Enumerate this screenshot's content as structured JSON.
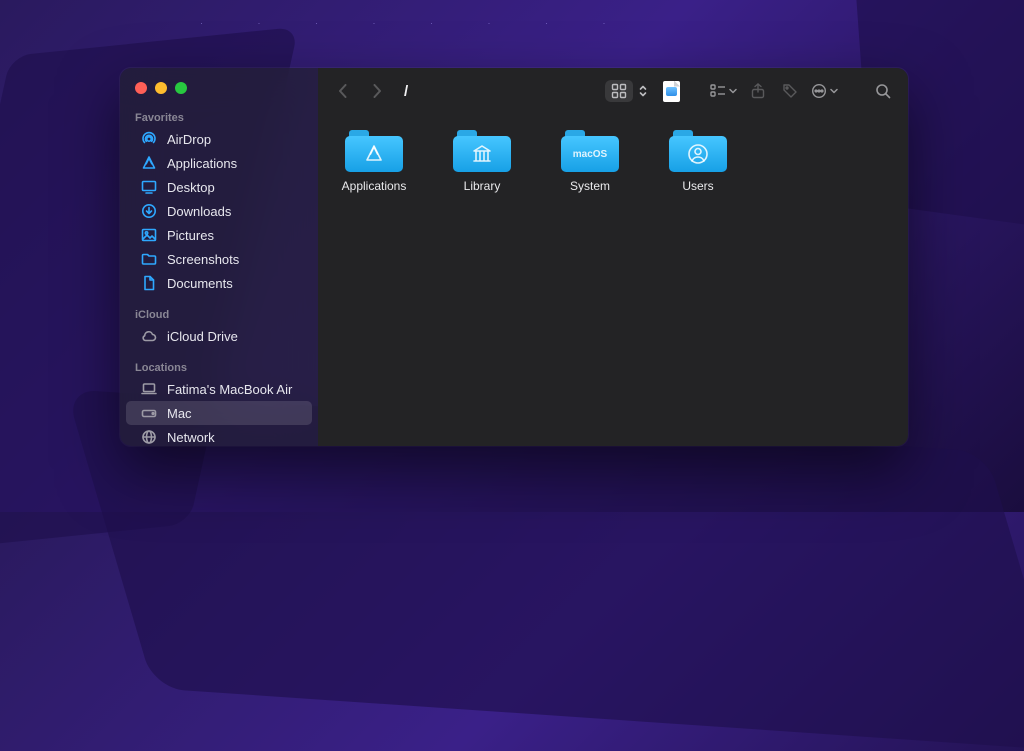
{
  "path_title": "/",
  "sidebar": {
    "sections": [
      {
        "label": "Favorites",
        "items": [
          {
            "icon": "airdrop",
            "label": "AirDrop"
          },
          {
            "icon": "apps",
            "label": "Applications"
          },
          {
            "icon": "desktop",
            "label": "Desktop"
          },
          {
            "icon": "downloads",
            "label": "Downloads"
          },
          {
            "icon": "pictures",
            "label": "Pictures"
          },
          {
            "icon": "folder",
            "label": "Screenshots"
          },
          {
            "icon": "documents",
            "label": "Documents"
          }
        ]
      },
      {
        "label": "iCloud",
        "items": [
          {
            "icon": "cloud",
            "label": "iCloud Drive"
          }
        ]
      },
      {
        "label": "Locations",
        "items": [
          {
            "icon": "laptop",
            "label": "Fatima's MacBook Air"
          },
          {
            "icon": "disk",
            "label": "Mac",
            "selected": true
          },
          {
            "icon": "globe",
            "label": "Network"
          }
        ]
      }
    ]
  },
  "folders": [
    {
      "label": "Applications",
      "glyph": "apps"
    },
    {
      "label": "Library",
      "glyph": "library"
    },
    {
      "label": "System",
      "glyph": "macos"
    },
    {
      "label": "Users",
      "glyph": "user"
    }
  ],
  "colors": {
    "accent": "#2ea8ff",
    "folder_top": "#46c6ff",
    "folder_bottom": "#17a0e6"
  }
}
